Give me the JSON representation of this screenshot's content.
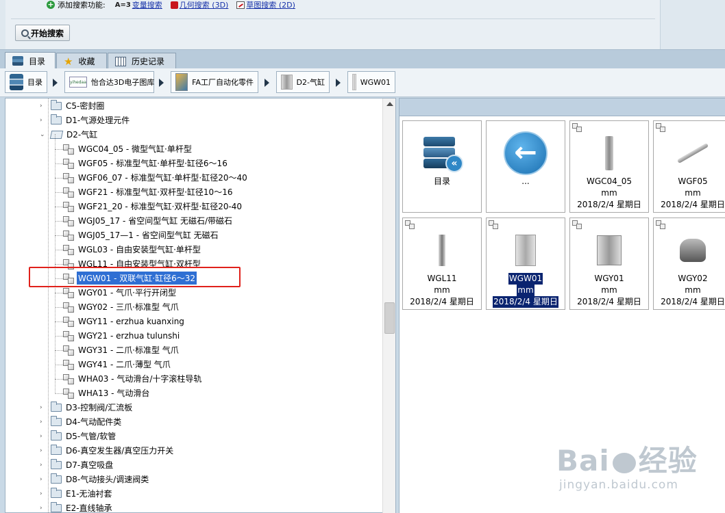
{
  "search": {
    "add_label": "添加搜索功能:",
    "functions": [
      {
        "icon": "A=3",
        "label": "变量搜索"
      },
      {
        "icon": "cube-icon",
        "label": "几何搜索 (3D)"
      },
      {
        "icon": "sketch-icon",
        "label": "草图搜索 (2D)"
      }
    ],
    "start_button": "开始搜索"
  },
  "tabs": [
    {
      "label": "目录",
      "icon": "books-icon",
      "active": true
    },
    {
      "label": "收藏",
      "icon": "star-icon",
      "active": false
    },
    {
      "label": "历史记录",
      "icon": "grid-icon",
      "active": false
    }
  ],
  "breadcrumb": [
    {
      "label": "目录",
      "icon": "books-icon"
    },
    {
      "label": "怡合达3D电子图库",
      "icon": "misumi-logo-icon",
      "logo_text": "yihedaa"
    },
    {
      "label": "FA工厂自动化零件",
      "icon": "fa-catalog-icon"
    },
    {
      "label": "D2-气缸",
      "icon": "cylinder-icon"
    },
    {
      "label": "WGW01",
      "icon": "part-icon"
    }
  ],
  "tree": [
    {
      "label": "C5-密封圈",
      "type": "folder",
      "level": 0,
      "expander": "+"
    },
    {
      "label": "D1-气源处理元件",
      "type": "folder",
      "level": 0,
      "expander": "+"
    },
    {
      "label": "D2-气缸",
      "type": "folder-open",
      "level": 0,
      "expander": "-"
    },
    {
      "label": "WGC04_05 - 微型气缸·单杆型",
      "type": "part",
      "level": 1
    },
    {
      "label": "WGF05 - 标准型气缸·单杆型·缸径6～16",
      "type": "part",
      "level": 1
    },
    {
      "label": "WGF06_07 - 标准型气缸·单杆型·缸径20～40",
      "type": "part",
      "level": 1
    },
    {
      "label": "WGF21 - 标准型气缸·双杆型·缸径10～16",
      "type": "part",
      "level": 1
    },
    {
      "label": "WGF21_20 - 标准型气缸·双杆型·缸径20-40",
      "type": "part",
      "level": 1
    },
    {
      "label": "WGJ05_17 - 省空间型气缸 无磁石/带磁石",
      "type": "part",
      "level": 1
    },
    {
      "label": "WGJ05_17—1 - 省空间型气缸 无磁石",
      "type": "part",
      "level": 1
    },
    {
      "label": "WGL03 - 自由安装型气缸·单杆型",
      "type": "part",
      "level": 1
    },
    {
      "label": "WGL11 - 自由安装型气缸·双杆型",
      "type": "part",
      "level": 1
    },
    {
      "label": "WGW01 - 双联气缸·缸径6～32",
      "type": "part",
      "level": 1,
      "selected": true
    },
    {
      "label": "WGY01 - 气爪·平行开闭型",
      "type": "part",
      "level": 1
    },
    {
      "label": "WGY02 - 三爪·标准型  气爪",
      "type": "part",
      "level": 1
    },
    {
      "label": "WGY11 - erzhua kuanxing",
      "type": "part",
      "level": 1
    },
    {
      "label": "WGY21 - erzhua tulunshi",
      "type": "part",
      "level": 1
    },
    {
      "label": "WGY31 - 二爪·标准型 气爪",
      "type": "part",
      "level": 1
    },
    {
      "label": "WGY41 - 二爪·薄型  气爪",
      "type": "part",
      "level": 1
    },
    {
      "label": "WHA03 - 气动滑台/十字滚柱导轨",
      "type": "part",
      "level": 1
    },
    {
      "label": "WHA13 - 气动滑台",
      "type": "part",
      "level": 1
    },
    {
      "label": "D3-控制阀/汇流板",
      "type": "folder",
      "level": 0,
      "expander": "+"
    },
    {
      "label": "D4-气动配件类",
      "type": "folder",
      "level": 0,
      "expander": "+"
    },
    {
      "label": "D5-气管/软管",
      "type": "folder",
      "level": 0,
      "expander": "+"
    },
    {
      "label": "D6-真空发生器/真空压力开关",
      "type": "folder",
      "level": 0,
      "expander": "+"
    },
    {
      "label": "D7-真空吸盘",
      "type": "folder",
      "level": 0,
      "expander": "+"
    },
    {
      "label": "D8-气动接头/调速阀类",
      "type": "folder",
      "level": 0,
      "expander": "+"
    },
    {
      "label": "E1-无油衬套",
      "type": "folder",
      "level": 0,
      "expander": "+"
    },
    {
      "label": "E2-直线轴承",
      "type": "folder",
      "level": 0,
      "expander": "+"
    }
  ],
  "cards": [
    {
      "kind": "books",
      "lines": [
        "目录"
      ]
    },
    {
      "kind": "back",
      "lines": [
        "..."
      ]
    },
    {
      "kind": "vert",
      "lines": [
        "WGC04_05",
        "mm",
        "2018/2/4 星期日"
      ]
    },
    {
      "kind": "rod",
      "lines": [
        "WGF05",
        "mm",
        "2018/2/4 星期日"
      ]
    },
    {
      "kind": "vert2",
      "lines": [
        "WGL11",
        "mm",
        "2018/2/4 星期日"
      ]
    },
    {
      "kind": "block",
      "lines": [
        "WGW01",
        "mm",
        "2018/2/4 星期日"
      ],
      "selected": true
    },
    {
      "kind": "gripper",
      "lines": [
        "WGY01",
        "mm",
        "2018/2/4 星期日"
      ]
    },
    {
      "kind": "round",
      "lines": [
        "WGY02",
        "mm",
        "2018/2/4 星期日"
      ]
    }
  ],
  "watermark": {
    "main_left": "Bai",
    "main_right": "经验",
    "sub": "jingyan.baidu.com"
  }
}
